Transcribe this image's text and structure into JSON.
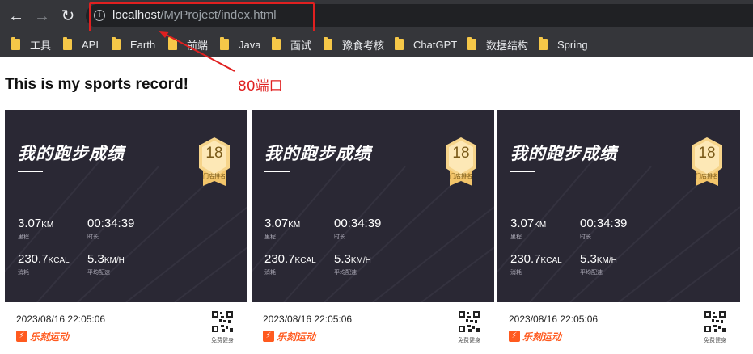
{
  "browser": {
    "url_host": "localhost",
    "url_path": "/MyProject/index.html",
    "back_icon": "arrow-left-icon",
    "forward_icon": "arrow-right-icon",
    "reload_icon": "reload-icon",
    "site_info_icon": "info-icon"
  },
  "bookmarks": [
    {
      "label": "工具"
    },
    {
      "label": "API"
    },
    {
      "label": "Earth"
    },
    {
      "label": "前端"
    },
    {
      "label": "Java"
    },
    {
      "label": "面试"
    },
    {
      "label": "豫食考核"
    },
    {
      "label": "ChatGPT"
    },
    {
      "label": "数据结构"
    },
    {
      "label": "Spring"
    }
  ],
  "annotation": {
    "text": "80端口",
    "color": "#e02020"
  },
  "page": {
    "title": "This is my sports record!"
  },
  "cards": [
    {
      "heading": "我的跑步成绩",
      "rank": "18",
      "rank_label": "门店排名",
      "distance": {
        "value": "3.07",
        "unit": "KM",
        "caption": "里程"
      },
      "duration": {
        "value": "00:34:39",
        "caption": "时长"
      },
      "calories": {
        "value": "230.7",
        "unit": "KCAL",
        "caption": "消耗"
      },
      "pace": {
        "value": "5.3",
        "unit": "KM/H",
        "caption": "平均配速"
      },
      "date": "2023/08/16 22:05:06",
      "brand": "乐刻运动",
      "qr_caption": "免费健身"
    },
    {
      "heading": "我的跑步成绩",
      "rank": "18",
      "rank_label": "门店排名",
      "distance": {
        "value": "3.07",
        "unit": "KM",
        "caption": "里程"
      },
      "duration": {
        "value": "00:34:39",
        "caption": "时长"
      },
      "calories": {
        "value": "230.7",
        "unit": "KCAL",
        "caption": "消耗"
      },
      "pace": {
        "value": "5.3",
        "unit": "KM/H",
        "caption": "平均配速"
      },
      "date": "2023/08/16 22:05:06",
      "brand": "乐刻运动",
      "qr_caption": "免费健身"
    },
    {
      "heading": "我的跑步成绩",
      "rank": "18",
      "rank_label": "门店排名",
      "distance": {
        "value": "3.07",
        "unit": "KM",
        "caption": "里程"
      },
      "duration": {
        "value": "00:34:39",
        "caption": "时长"
      },
      "calories": {
        "value": "230.7",
        "unit": "KCAL",
        "caption": "消耗"
      },
      "pace": {
        "value": "5.3",
        "unit": "KM/H",
        "caption": "平均配速"
      },
      "date": "2023/08/16 22:05:06",
      "brand": "乐刻运动",
      "qr_caption": "免费健身"
    }
  ],
  "colors": {
    "chrome": "#35363a",
    "card_bg": "#2a2834",
    "brand": "#ff5a1f",
    "badge": "#f6d48a"
  }
}
